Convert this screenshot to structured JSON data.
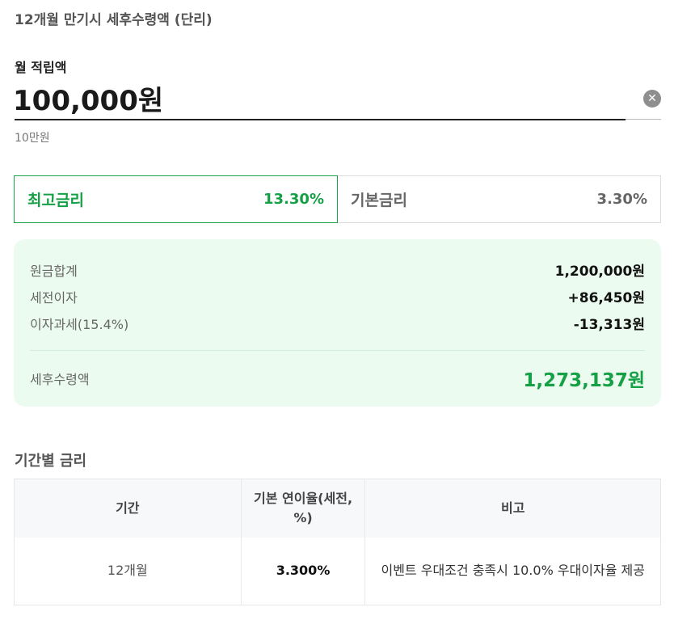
{
  "title": "12개월 만기시 세후수령액 (단리)",
  "monthly": {
    "label": "월 적립액",
    "value": "100,000원",
    "helper": "10만원",
    "clear_icon": "close-icon"
  },
  "rate_tabs": [
    {
      "label": "최고금리",
      "value": "13.30%",
      "selected": true
    },
    {
      "label": "기본금리",
      "value": "3.30%",
      "selected": false
    }
  ],
  "summary": {
    "principal_label": "원금합계",
    "principal_value": "1,200,000원",
    "pretax_label": "세전이자",
    "pretax_value": "+86,450원",
    "tax_label": "이자과세(15.4%)",
    "tax_value": "-13,313원",
    "net_label": "세후수령액",
    "net_value": "1,273,137원"
  },
  "period_section": {
    "title": "기간별 금리",
    "headers": [
      "기간",
      "기본 연이율(세전, %)",
      "비고"
    ],
    "rows": [
      {
        "period": "12개월",
        "rate": "3.300%",
        "note": "이벤트 우대조건 충족시 10.0% 우대이자율 제공"
      }
    ]
  },
  "colors": {
    "accent": "#16a046",
    "summary_bg": "#ebfbef"
  }
}
